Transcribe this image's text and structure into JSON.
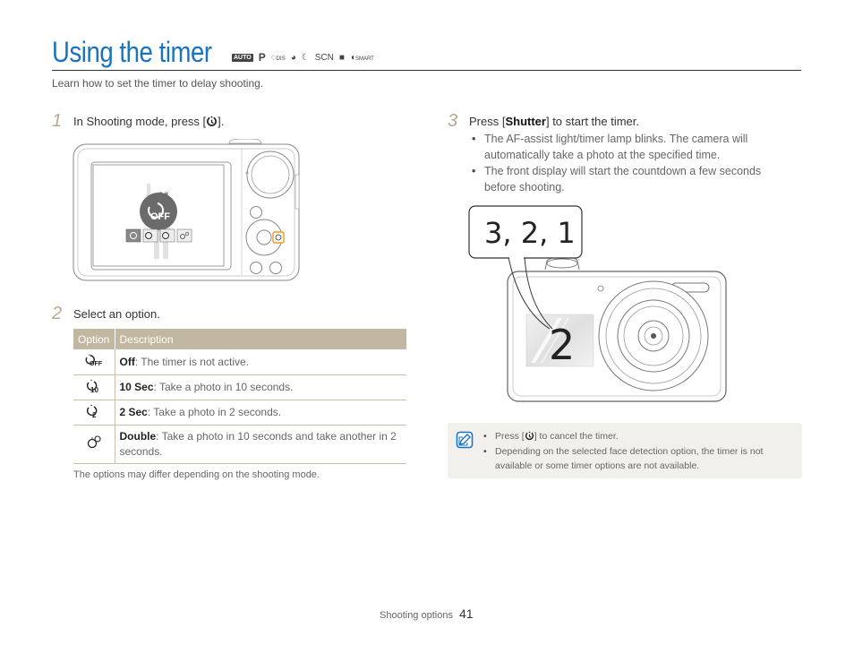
{
  "header": {
    "title": "Using the timer",
    "modes": [
      "AUTO",
      "P",
      "DIS",
      "Beauty",
      "Night",
      "SCN",
      "Movie",
      "SMART"
    ],
    "mode_labels": {
      "auto": "AUTO",
      "p": "P",
      "dis": "DIS",
      "scn": "SCN",
      "smart": "SMART"
    },
    "intro": "Learn how to set the timer to delay shooting."
  },
  "step1": {
    "number": "1",
    "text_before": "In Shooting mode, press [",
    "icon": "timer-icon",
    "text_after": "].",
    "illustration": {
      "screen_label": "Off",
      "screen_big_icon": "timer-off-icon",
      "screen_options": [
        "timer-off-icon",
        "timer-10-icon",
        "timer-2-icon",
        "timer-double-icon"
      ]
    }
  },
  "step2": {
    "number": "2",
    "text": "Select an option.",
    "table": {
      "headers": [
        "Option",
        "Description"
      ],
      "rows": [
        {
          "icon": "timer-off-icon",
          "name": "Off",
          "desc": ": The timer is not active."
        },
        {
          "icon": "timer-10-icon",
          "name": "10 Sec",
          "desc": ": Take a photo in 10 seconds."
        },
        {
          "icon": "timer-2-icon",
          "name": "2 Sec",
          "desc": ": Take a photo in 2 seconds."
        },
        {
          "icon": "timer-double-icon",
          "name": "Double",
          "desc": ": Take a photo in 10 seconds and take another in 2 seconds."
        }
      ]
    },
    "footnote": "The options may differ depending on the shooting mode."
  },
  "step3": {
    "number": "3",
    "text_before": "Press [",
    "bold": "Shutter",
    "text_after": "] to start the timer.",
    "bullets": [
      "The AF-assist light/timer lamp blinks. The camera will automatically take a photo at the specified time.",
      "The front display will start the countdown a few seconds before shooting."
    ],
    "illustration": {
      "callout": "3, 2, 1",
      "front_display": "2"
    }
  },
  "note": {
    "icon": "note-icon",
    "item1_before": "Press [",
    "item1_after": "] to cancel the timer.",
    "item2": "Depending on the selected face detection option, the timer is not available or some timer options are not available."
  },
  "footer": {
    "section": "Shooting options",
    "page": "41"
  },
  "colors": {
    "title": "#1a73c0",
    "step_number": "#b9a98d",
    "table_header": "#c2b7a0",
    "highlight": "#f39a1e",
    "note_bg": "#f2f0ed",
    "note_icon": "#1a73c0"
  }
}
